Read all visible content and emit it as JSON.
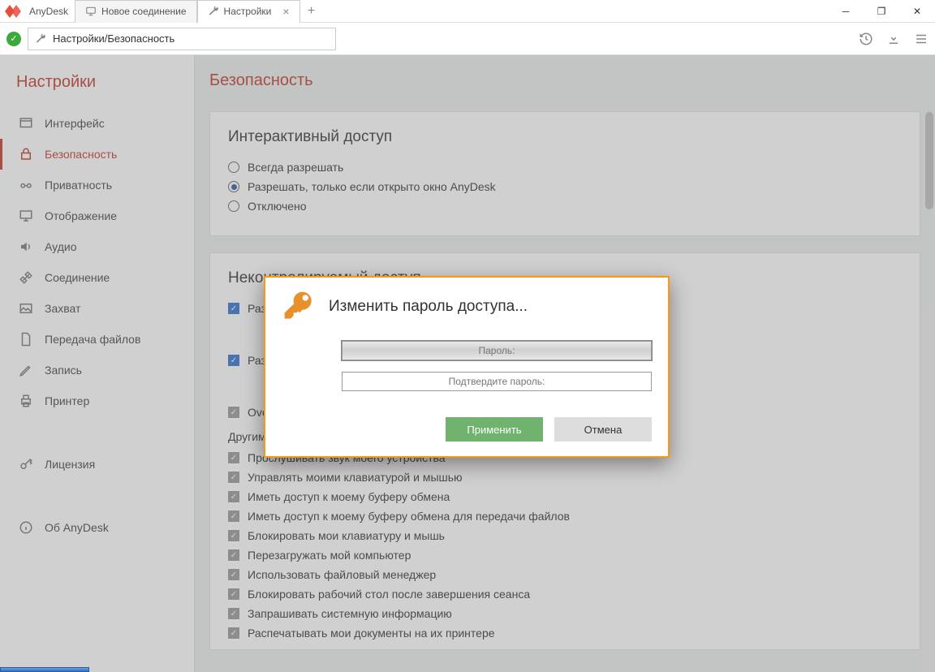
{
  "app": {
    "name": "AnyDesk"
  },
  "tabs": [
    {
      "label": "Новое соединение",
      "active": false
    },
    {
      "label": "Настройки",
      "active": true
    }
  ],
  "address": {
    "path": "Настройки/Безопасность"
  },
  "sidebar": {
    "title": "Настройки",
    "items": [
      {
        "label": "Интерфейс",
        "active": false
      },
      {
        "label": "Безопасность",
        "active": true
      },
      {
        "label": "Приватность",
        "active": false
      },
      {
        "label": "Отображение",
        "active": false
      },
      {
        "label": "Аудио",
        "active": false
      },
      {
        "label": "Соединение",
        "active": false
      },
      {
        "label": "Захват",
        "active": false
      },
      {
        "label": "Передача файлов",
        "active": false
      },
      {
        "label": "Запись",
        "active": false
      },
      {
        "label": "Принтер",
        "active": false
      }
    ],
    "license": "Лицензия",
    "about": "Об AnyDesk"
  },
  "page": {
    "title": "Безопасность",
    "interactive": {
      "heading": "Интерактивный доступ",
      "options": [
        {
          "label": "Всегда разрешать",
          "selected": false
        },
        {
          "label": "Разрешать, только если открыто окно AnyDesk",
          "selected": true
        },
        {
          "label": "Отключено",
          "selected": false
        }
      ]
    },
    "unattended": {
      "heading": "Неконтролируемый доступ",
      "chk1": "Разр",
      "chk2": "Разр",
      "chk3": "Over",
      "perm_intro": "Другим пользователям AnyDesk разрешено...",
      "perms": [
        "Прослушивать звук моего устройства",
        "Управлять моими клавиатурой и мышью",
        "Иметь доступ к моему буферу обмена",
        "Иметь доступ к моему буферу обмена для передачи файлов",
        "Блокировать мои клавиатуру и мышь",
        "Перезагружать мой компьютер",
        "Использовать файловый менеджер",
        "Блокировать рабочий стол после завершения сеанса",
        "Запрашивать системную информацию",
        "Распечатывать мои документы на их принтере"
      ]
    }
  },
  "modal": {
    "title": "Изменить пароль доступа...",
    "pw_label": "Пароль:",
    "pw2_label": "Подтвердите пароль:",
    "apply": "Применить",
    "cancel": "Отмена"
  }
}
